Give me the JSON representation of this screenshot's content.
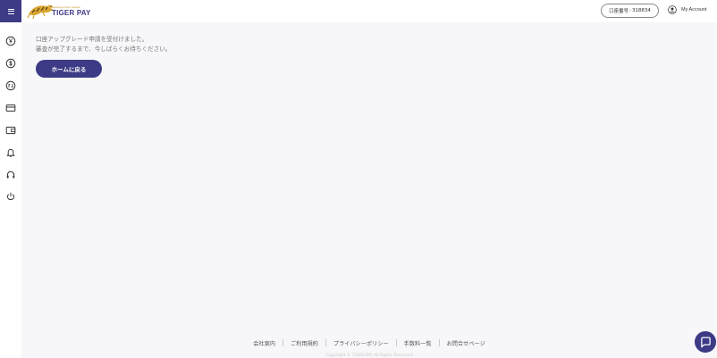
{
  "header": {
    "brand_tagline": "Global payment solution",
    "brand_name": "TIGER PAY",
    "account_label": "口座番号",
    "account_separator": ":",
    "account_number": "318834",
    "my_account_label": "My Account"
  },
  "sidebar": {
    "items": [
      {
        "icon": "yen-circle-icon"
      },
      {
        "icon": "dollar-circle-icon"
      },
      {
        "icon": "transfer-circle-icon"
      },
      {
        "icon": "credit-card-icon"
      },
      {
        "icon": "wallet-icon"
      },
      {
        "icon": "bell-icon"
      },
      {
        "icon": "headset-icon"
      },
      {
        "icon": "power-icon"
      }
    ]
  },
  "main": {
    "message_line1": "口座アップグレード申請を受付けました。",
    "message_line2": "審査が完了するまで、今しばらくお待ちください。",
    "home_button_label": "ホームに戻る"
  },
  "footer": {
    "links": [
      "会社案内",
      "ご利用規約",
      "プライバシーポリシー",
      "手数料一覧",
      "お問合せページ"
    ],
    "copyright": "Copyright © TIGER PAY All Rights Reserved"
  },
  "colors": {
    "primary": "#3d3a86",
    "background": "#f7f7f9",
    "sidebar": "#ffffff",
    "logo_gold": "#c89b2a"
  }
}
